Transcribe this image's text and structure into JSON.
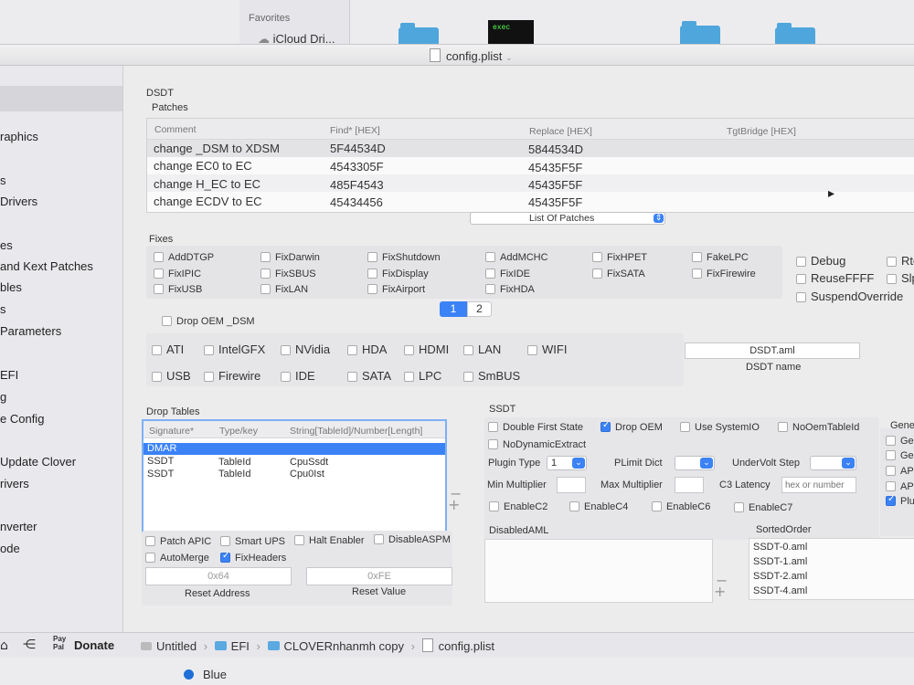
{
  "finder": {
    "favorites_label": "Favorites",
    "icloud_label": "iCloud Dri...",
    "exec_label": "exec"
  },
  "window": {
    "title": "config.plist"
  },
  "sidebar": {
    "items": [
      "raphics",
      "s",
      "Drivers",
      "es",
      "and Kext Patches",
      "bles",
      "s",
      "Parameters",
      "EFI",
      "g",
      "e Config",
      "Update Clover",
      "rivers",
      "nverter",
      "ode"
    ]
  },
  "dsdt": {
    "section_label": "DSDT",
    "patches_label": "Patches",
    "columns": [
      "Comment",
      "Find* [HEX]",
      "Replace [HEX]",
      "TgtBridge [HEX]"
    ],
    "rows": [
      [
        "change _DSM to XDSM",
        "5F44534D",
        "5844534D",
        ""
      ],
      [
        "change EC0 to EC",
        "4543305F",
        "45435F5F",
        ""
      ],
      [
        "change H_EC to EC",
        "485F4543",
        "45435F5F",
        ""
      ],
      [
        "change ECDV to EC",
        "45434456",
        "45435F5F",
        ""
      ]
    ],
    "list_popup": "List Of Patches",
    "fixes_label": "Fixes",
    "fixes": [
      [
        "AddDTGP",
        "FixDarwin",
        "FixShutdown",
        "AddMCHC",
        "FixHPET",
        "FakeLPC"
      ],
      [
        "FixIPIC",
        "FixSBUS",
        "FixDisplay",
        "FixIDE",
        "FixSATA",
        "FixFirewire"
      ],
      [
        "FixUSB",
        "FixLAN",
        "FixAirport",
        "FixHDA",
        "",
        ""
      ]
    ],
    "right_fixes": [
      "Debug",
      "Rtc",
      "ReuseFFFF",
      "Slp",
      "SuspendOverride"
    ],
    "pages": [
      "1",
      "2"
    ],
    "drop_oem_dsm": "Drop OEM _DSM",
    "devices_row1": [
      "ATI",
      "IntelGFX",
      "NVidia",
      "HDA",
      "HDMI",
      "LAN",
      "WIFI"
    ],
    "devices_row2": [
      "USB",
      "Firewire",
      "IDE",
      "SATA",
      "LPC",
      "SmBUS"
    ],
    "dsdt_name_value": "DSDT.aml",
    "dsdt_name_label": "DSDT name"
  },
  "drop_tables": {
    "label": "Drop Tables",
    "columns": [
      "Signature*",
      "Type/key",
      "String[TableId]/Number[Length]"
    ],
    "rows": [
      [
        "DMAR",
        "",
        ""
      ],
      [
        "SSDT",
        "TableId",
        "CpuSsdt"
      ],
      [
        "SSDT",
        "TableId",
        "Cpu0Ist"
      ]
    ]
  },
  "options": {
    "patch_apic": "Patch APIC",
    "smart_ups": "Smart UPS",
    "halt_enabler": "Halt Enabler",
    "disable_aspm": "DisableASPM",
    "auto_merge": "AutoMerge",
    "fix_headers": "FixHeaders",
    "reset_address_value": "0x64",
    "reset_address_label": "Reset Address",
    "reset_value_value": "0xFE",
    "reset_value_label": "Reset Value"
  },
  "ssdt": {
    "label": "SSDT",
    "double_first_state": "Double First State",
    "drop_oem": "Drop OEM",
    "use_system_io": "Use SystemIO",
    "no_oem_table_id": "NoOemTableId",
    "no_dynamic_extract": "NoDynamicExtract",
    "plugin_type_label": "Plugin Type",
    "plugin_type_value": "1",
    "plimit_dict_label": "PLimit Dict",
    "undervolt_step_label": "UnderVolt Step",
    "min_multiplier_label": "Min Multiplier",
    "max_multiplier_label": "Max Multiplier",
    "c3_latency_label": "C3 Latency",
    "c3_latency_placeholder": "hex or number",
    "enable_c2": "EnableC2",
    "enable_c4": "EnableC4",
    "enable_c6": "EnableC6",
    "enable_c7": "EnableC7",
    "generate_label": "Gene",
    "generate_items": [
      "Gen",
      "Gen",
      "APS",
      "APL",
      "Plu"
    ]
  },
  "disabled_aml": {
    "label": "DisabledAML"
  },
  "sorted_order": {
    "label": "SortedOrder",
    "items": [
      "SSDT-0.aml",
      "SSDT-1.aml",
      "SSDT-2.aml",
      "SSDT-4.aml"
    ]
  },
  "bottombar": {
    "donate_label": "Donate",
    "paypal_label": "Pay Pal",
    "path": [
      "Untitled",
      "EFI",
      "CLOVERnhanmh copy",
      "config.plist"
    ]
  },
  "below": {
    "tag_label": "Blue"
  },
  "colors": {
    "accent": "#3b82f6",
    "selection": "#3b82f6",
    "tag_blue": "#1f6fd6"
  }
}
